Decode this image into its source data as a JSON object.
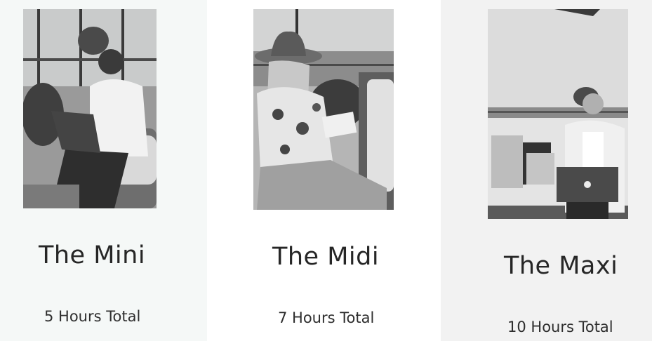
{
  "packages": [
    {
      "title": "The Mini",
      "hours": "5 Hours Total",
      "photo": "woman-on-laptop-photo"
    },
    {
      "title": "The Midi",
      "hours": "7 Hours Total",
      "photo": "woman-in-hat-writing-photo"
    },
    {
      "title": "The Maxi",
      "hours": "10 Hours Total",
      "photo": "woman-with-shopping-bags-photo"
    }
  ],
  "colors": {
    "mini_bg": "#f5f8f7",
    "midi_bg": "#ffffff",
    "maxi_bg": "#f2f2f2",
    "text": "#262626"
  }
}
